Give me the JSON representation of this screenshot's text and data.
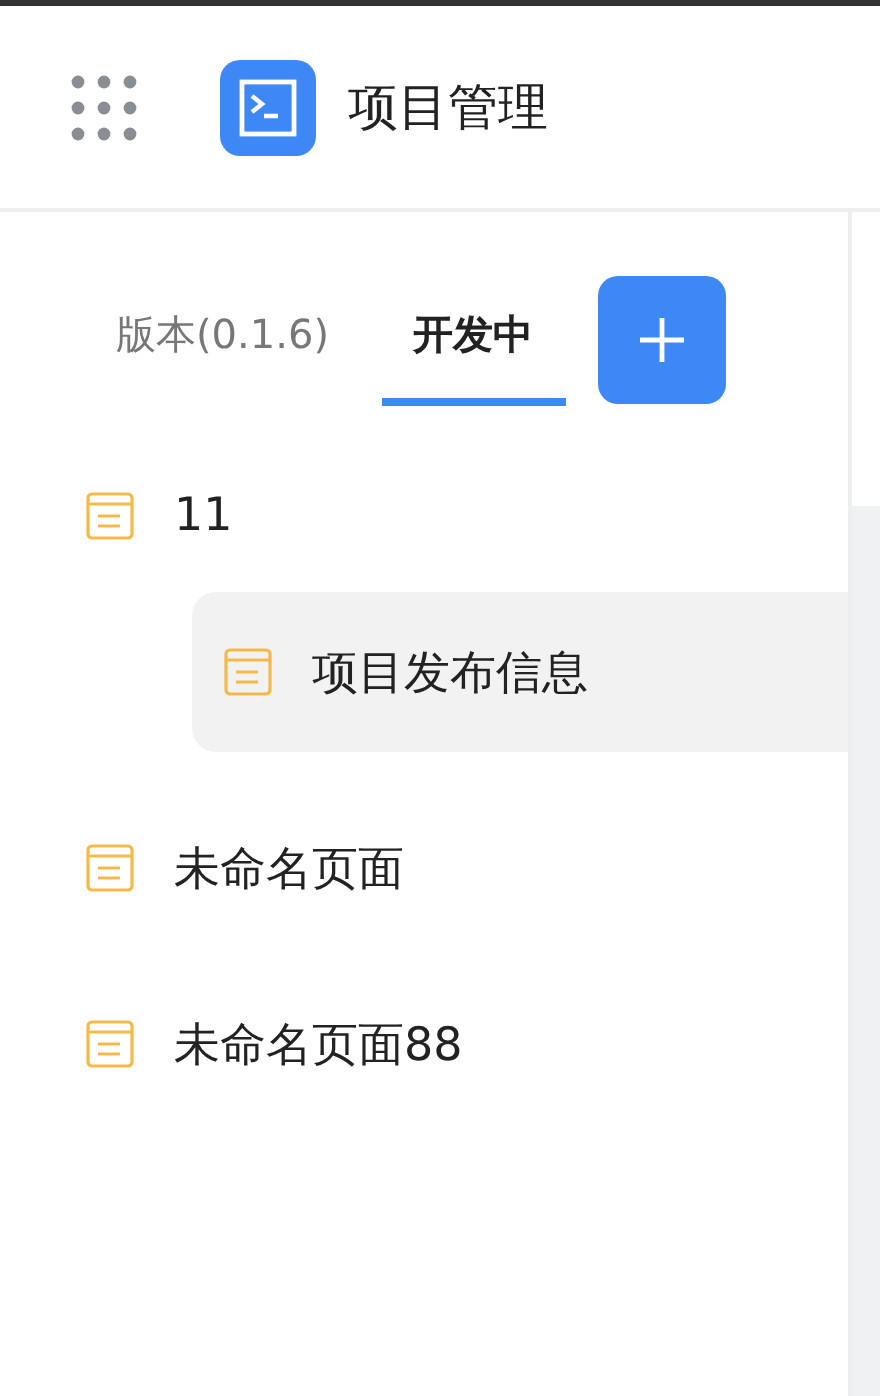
{
  "header": {
    "title": "项目管理"
  },
  "tabs": [
    {
      "label": "版本(0.1.6)",
      "selected": false
    },
    {
      "label": "开发中",
      "selected": true
    }
  ],
  "tree": [
    {
      "label": "11",
      "selected": false,
      "children": [
        {
          "label": "项目发布信息",
          "selected": true
        }
      ]
    },
    {
      "label": "未命名页面",
      "selected": false
    },
    {
      "label": "未命名页面88",
      "selected": false
    }
  ]
}
